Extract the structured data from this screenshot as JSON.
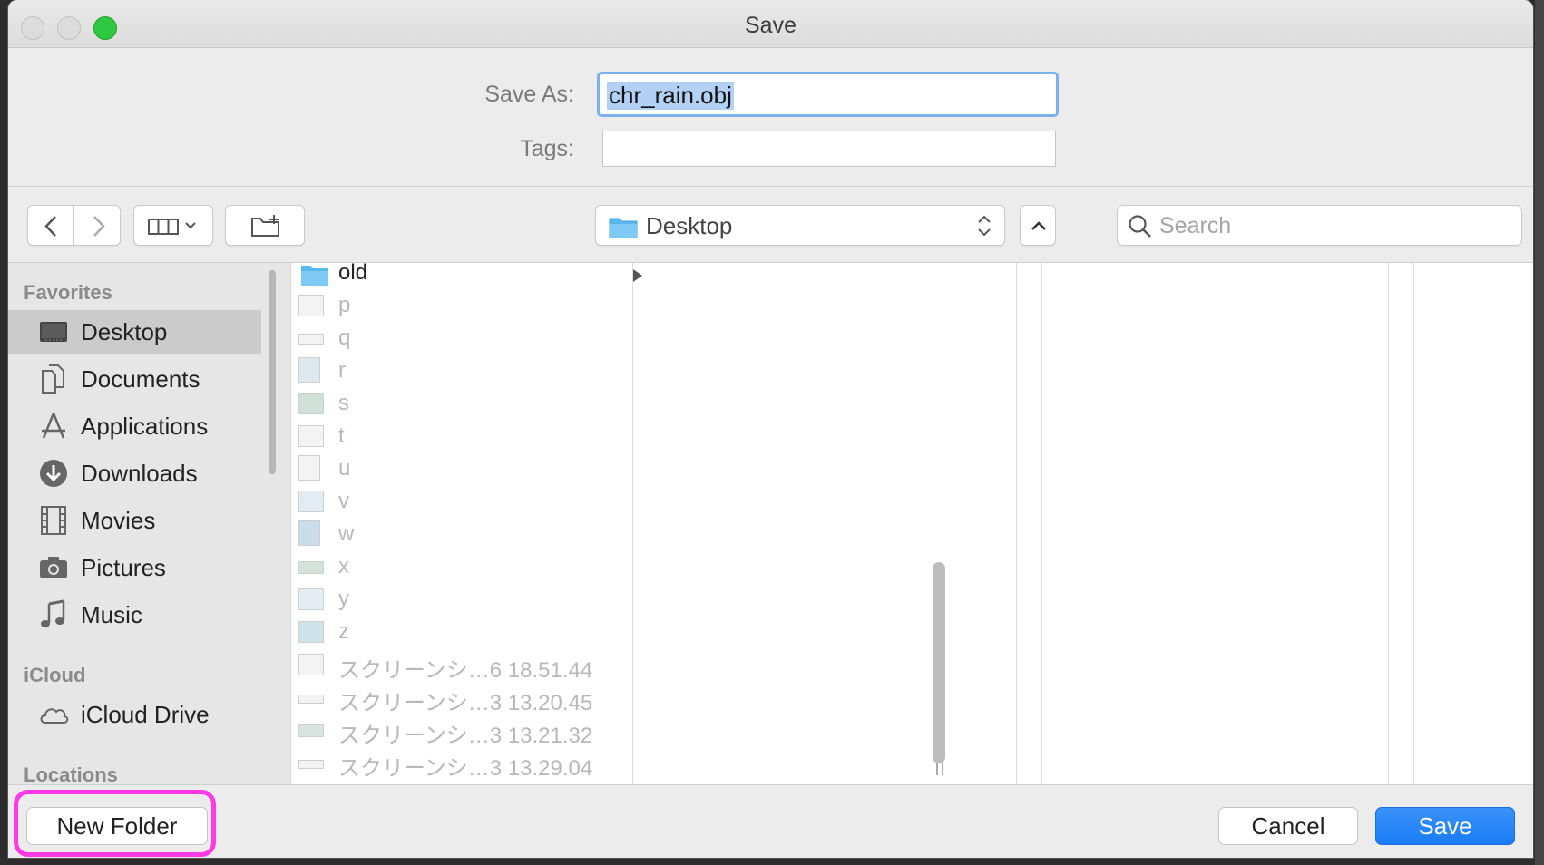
{
  "window": {
    "title": "Save"
  },
  "form": {
    "save_as_label": "Save As:",
    "save_as_value": "chr_rain.obj",
    "tags_label": "Tags:",
    "tags_value": ""
  },
  "toolbar": {
    "back_icon": "chevron-left-icon",
    "forward_icon": "chevron-right-icon",
    "view_icon": "column-view-icon",
    "new_folder_icon": "folder-plus-icon",
    "location": "Desktop",
    "search_placeholder": "Search"
  },
  "sidebar": {
    "favorites_header": "Favorites",
    "favorites": [
      {
        "label": "Desktop",
        "icon": "desktop-icon",
        "selected": true
      },
      {
        "label": "Documents",
        "icon": "documents-icon"
      },
      {
        "label": "Applications",
        "icon": "applications-icon"
      },
      {
        "label": "Downloads",
        "icon": "downloads-icon"
      },
      {
        "label": "Movies",
        "icon": "movies-icon"
      },
      {
        "label": "Pictures",
        "icon": "pictures-icon"
      },
      {
        "label": "Music",
        "icon": "music-icon"
      }
    ],
    "icloud_header": "iCloud",
    "icloud": [
      {
        "label": "iCloud Drive",
        "icon": "cloud-icon"
      }
    ],
    "locations_header": "Locations"
  },
  "files": [
    {
      "name": "old",
      "type": "folder"
    },
    {
      "name": "p"
    },
    {
      "name": "q"
    },
    {
      "name": "r"
    },
    {
      "name": "s"
    },
    {
      "name": "t"
    },
    {
      "name": "u"
    },
    {
      "name": "v"
    },
    {
      "name": "w"
    },
    {
      "name": "x"
    },
    {
      "name": "y"
    },
    {
      "name": "z"
    },
    {
      "name": "スクリーンシ…6 18.51.44"
    },
    {
      "name": "スクリーンシ…3 13.20.45"
    },
    {
      "name": "スクリーンシ…3 13.21.32"
    },
    {
      "name": "スクリーンシ…3 13.29.04"
    }
  ],
  "footer": {
    "new_folder_label": "New Folder",
    "cancel_label": "Cancel",
    "save_label": "Save"
  },
  "colors": {
    "accent": "#1a7cf6",
    "highlight": "#ff3be8",
    "folder": "#5ab8f0"
  }
}
